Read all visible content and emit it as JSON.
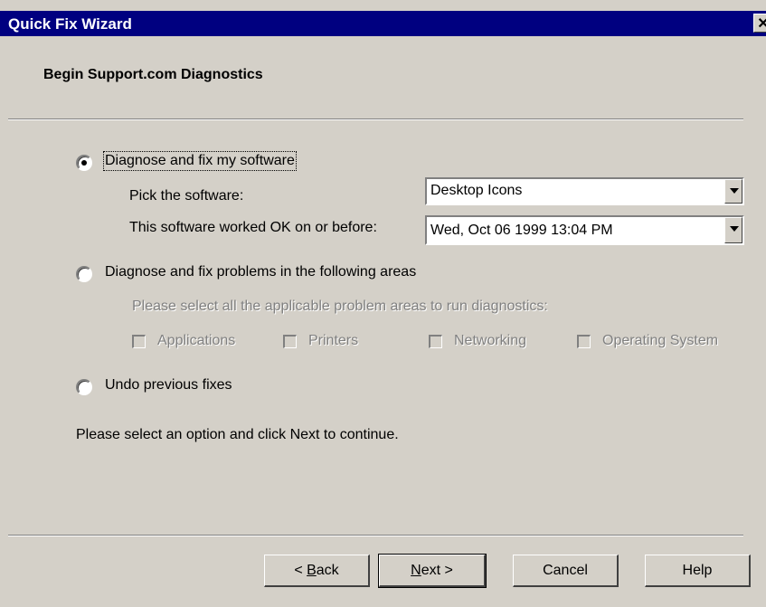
{
  "window": {
    "title": "Quick Fix Wizard",
    "close_glyph": "✕"
  },
  "header": {
    "title": "Begin Support.com Diagnostics"
  },
  "option_software": {
    "label": "Diagnose and fix my software",
    "selected": true,
    "pick_label": "Pick the software:",
    "pick_value": "Desktop Icons",
    "date_label": "This software worked OK on or before:",
    "date_value": "Wed, Oct 06 1999 13:04 PM"
  },
  "option_areas": {
    "label": "Diagnose and fix problems in the following areas",
    "selected": false,
    "instruction": "Please select all the applicable problem areas to run diagnostics:",
    "checkboxes": [
      "Applications",
      "Printers",
      "Networking",
      "Operating System"
    ]
  },
  "option_undo": {
    "label": "Undo previous fixes",
    "selected": false
  },
  "hint": "Please select an option  and click Next to continue.",
  "buttons": {
    "back": {
      "mnemonic": "B",
      "rest": "ack",
      "prefix": "< "
    },
    "next": {
      "mnemonic": "N",
      "rest": "ext >"
    },
    "cancel": "Cancel",
    "help": "Help"
  },
  "colors": {
    "titlebar": "#000080",
    "face": "#d4d0c8",
    "disabled_text": "#808080"
  }
}
